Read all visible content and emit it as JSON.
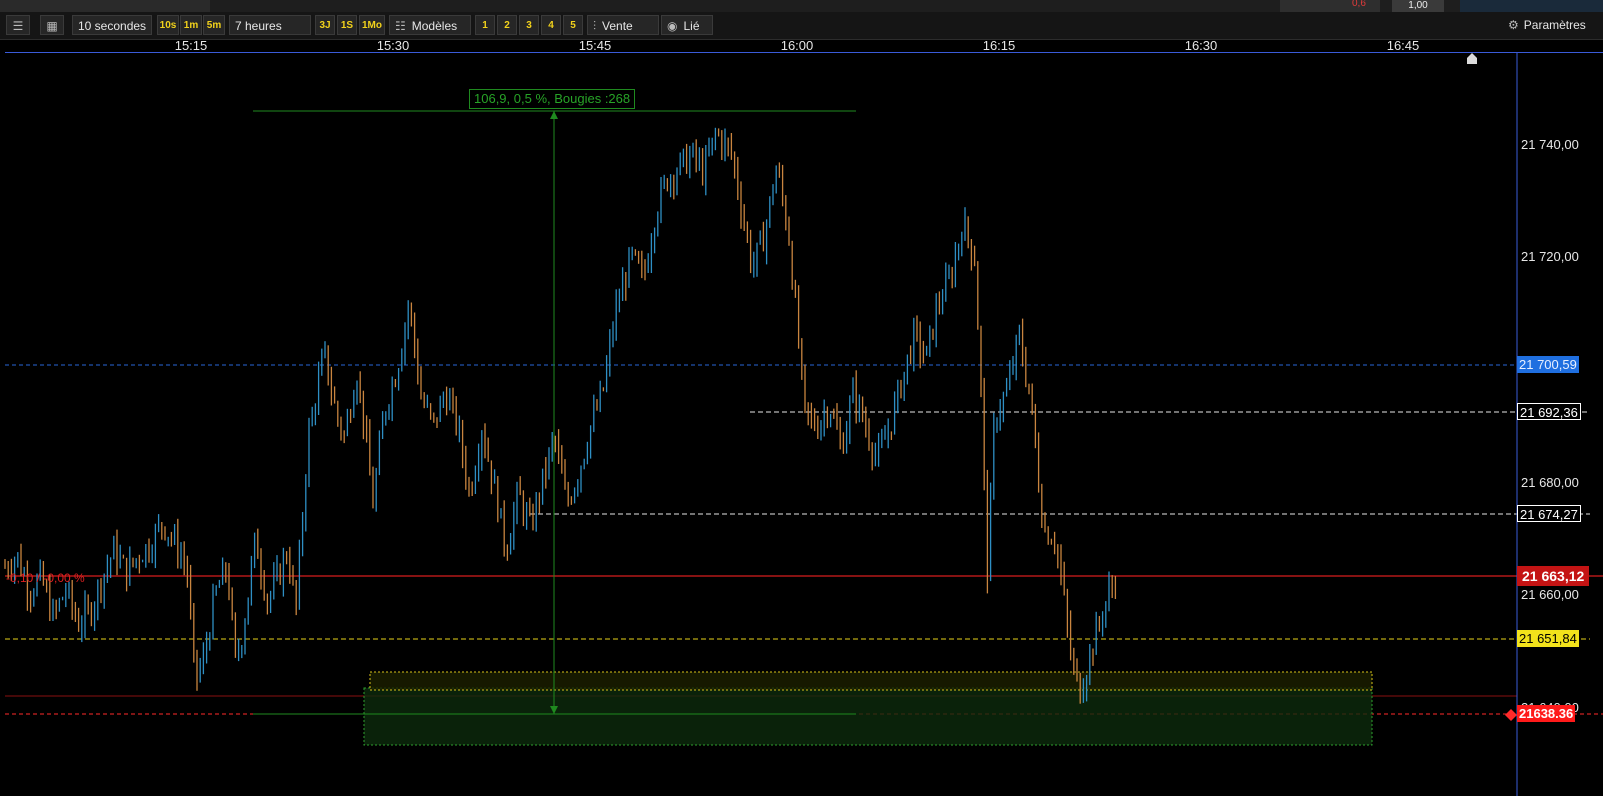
{
  "top_bar": {
    "value_red": "0,6",
    "value_box": "1,00"
  },
  "toolbar": {
    "interval": "10 secondes",
    "intervals": [
      "10s",
      "1m",
      "5m"
    ],
    "duration": "7 heures",
    "ranges": [
      "3J",
      "1S",
      "1Mo"
    ],
    "templates_label": "Modèles",
    "slots": [
      "1",
      "2",
      "3",
      "4",
      "5"
    ],
    "sell_label": "Vente",
    "linked_label": "Lié",
    "settings_label": "Paramètres"
  },
  "time_axis": [
    "15:15",
    "15:30",
    "15:45",
    "16:00",
    "16:15",
    "16:30",
    "16:45"
  ],
  "price_axis": [
    "21 740,00",
    "21 720,00",
    "21 680,00",
    "21 660,00",
    "21 640,00"
  ],
  "price_labels": {
    "blue": "21 700,59",
    "white_1": "21 692,36",
    "white_2": "21 674,27",
    "last": "21 663,12",
    "yellow": "21 651,84",
    "stop": "21638.36"
  },
  "measure_label": "106,9, 0,5 %, Bougies :268",
  "pnl_label": "-0,10 / -0,00 %",
  "colors": {
    "up": "#2e8fc4",
    "down": "#c9853f",
    "last_line": "#d61e1e",
    "blue_line": "#2966d9",
    "yellow_line": "#e6d21a",
    "measure": "#1f8a1f",
    "zone": "#0d2a0d"
  },
  "chart_data": {
    "type": "candlestick",
    "interval": "10s",
    "x_range": [
      "15:05",
      "16:51"
    ],
    "ylim": [
      21620,
      21751
    ],
    "last_price": 21663.12,
    "levels": [
      21700.59,
      21692.36,
      21674.27,
      21651.84,
      21638.36
    ],
    "close_path": [
      [
        0,
        21665
      ],
      [
        0.03,
        21667
      ],
      [
        0.06,
        21661
      ],
      [
        0.09,
        21663
      ],
      [
        0.12,
        21656
      ],
      [
        0.15,
        21661
      ],
      [
        0.18,
        21655
      ],
      [
        0.21,
        21657
      ],
      [
        0.24,
        21663
      ],
      [
        0.27,
        21668
      ],
      [
        0.3,
        21664
      ],
      [
        0.33,
        21667
      ],
      [
        0.36,
        21669
      ],
      [
        0.39,
        21673
      ],
      [
        0.43,
        21668
      ],
      [
        0.45,
        21665
      ],
      [
        0.47,
        21645
      ],
      [
        0.49,
        21648
      ],
      [
        0.52,
        21660
      ],
      [
        0.55,
        21665
      ],
      [
        0.57,
        21648
      ],
      [
        0.59,
        21654
      ],
      [
        0.62,
        21670
      ],
      [
        0.65,
        21659
      ],
      [
        0.68,
        21664
      ],
      [
        0.7,
        21668
      ],
      [
        0.72,
        21657
      ],
      [
        0.75,
        21688
      ],
      [
        0.79,
        21703
      ],
      [
        0.82,
        21692
      ],
      [
        0.84,
        21688
      ],
      [
        0.87,
        21700
      ],
      [
        0.89,
        21690
      ],
      [
        0.91,
        21676
      ],
      [
        0.94,
        21693
      ],
      [
        0.97,
        21700
      ],
      [
        1.0,
        21712
      ],
      [
        1.03,
        21695
      ],
      [
        1.06,
        21690
      ],
      [
        1.09,
        21696
      ],
      [
        1.12,
        21690
      ],
      [
        1.15,
        21678
      ],
      [
        1.18,
        21690
      ],
      [
        1.22,
        21676
      ],
      [
        1.24,
        21668
      ],
      [
        1.27,
        21678
      ],
      [
        1.3,
        21672
      ],
      [
        1.33,
        21680
      ],
      [
        1.36,
        21688
      ],
      [
        1.39,
        21676
      ],
      [
        1.42,
        21682
      ],
      [
        1.45,
        21690
      ],
      [
        1.48,
        21696
      ],
      [
        1.51,
        21710
      ],
      [
        1.55,
        21720
      ],
      [
        1.58,
        21716
      ],
      [
        1.61,
        21728
      ],
      [
        1.64,
        21734
      ],
      [
        1.67,
        21736
      ],
      [
        1.7,
        21738
      ],
      [
        1.73,
        21735
      ],
      [
        1.76,
        21742
      ],
      [
        1.78,
        21740
      ],
      [
        1.8,
        21738
      ],
      [
        1.82,
        21730
      ],
      [
        1.85,
        21718
      ],
      [
        1.88,
        21724
      ],
      [
        1.91,
        21736
      ],
      [
        1.94,
        21724
      ],
      [
        1.96,
        21708
      ],
      [
        1.98,
        21692
      ],
      [
        2.01,
        21690
      ],
      [
        2.04,
        21694
      ],
      [
        2.07,
        21686
      ],
      [
        2.1,
        21696
      ],
      [
        2.13,
        21690
      ],
      [
        2.16,
        21684
      ],
      [
        2.19,
        21690
      ],
      [
        2.22,
        21698
      ],
      [
        2.25,
        21706
      ],
      [
        2.28,
        21702
      ],
      [
        2.31,
        21712
      ],
      [
        2.34,
        21716
      ],
      [
        2.37,
        21726
      ],
      [
        2.4,
        21720
      ],
      [
        2.42,
        21690
      ],
      [
        2.43,
        21662
      ],
      [
        2.45,
        21692
      ],
      [
        2.48,
        21696
      ],
      [
        2.51,
        21706
      ],
      [
        2.54,
        21694
      ],
      [
        2.57,
        21672
      ],
      [
        2.6,
        21670
      ],
      [
        2.62,
        21660
      ],
      [
        2.64,
        21648
      ],
      [
        2.66,
        21643
      ],
      [
        2.68,
        21648
      ],
      [
        2.7,
        21653
      ],
      [
        2.73,
        21660
      ],
      [
        2.75,
        21663
      ]
    ],
    "box": {
      "x": [
        1.15,
        4.75
      ],
      "y": [
        21624,
        21656
      ]
    }
  }
}
